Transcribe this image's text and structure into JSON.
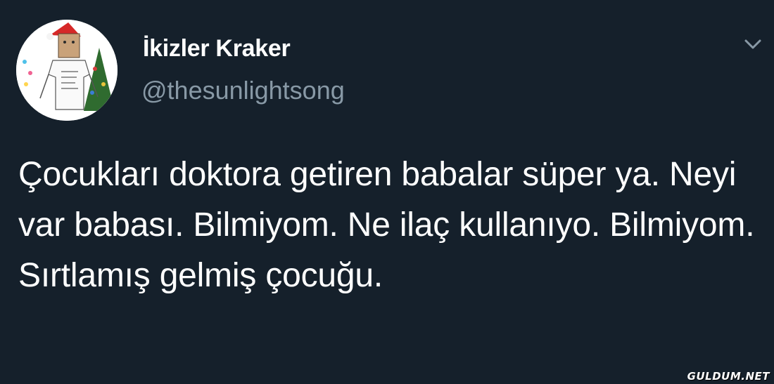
{
  "tweet": {
    "display_name": "İkizler Kraker",
    "handle": "@thesunlightsong",
    "text": "Çocukları doktora getiren babalar süper ya. Neyi var babası. Bilmiyom. Ne ilaç kullanıyo. Bilmiyom. Sırtlamış gelmiş çocuğu."
  },
  "icons": {
    "avatar": "profile-avatar",
    "menu": "chevron-down-icon"
  },
  "watermark": {
    "text": "GULDUM.NET"
  },
  "colors": {
    "background": "#15202b",
    "text": "#ffffff",
    "secondary_text": "#8899a6"
  }
}
